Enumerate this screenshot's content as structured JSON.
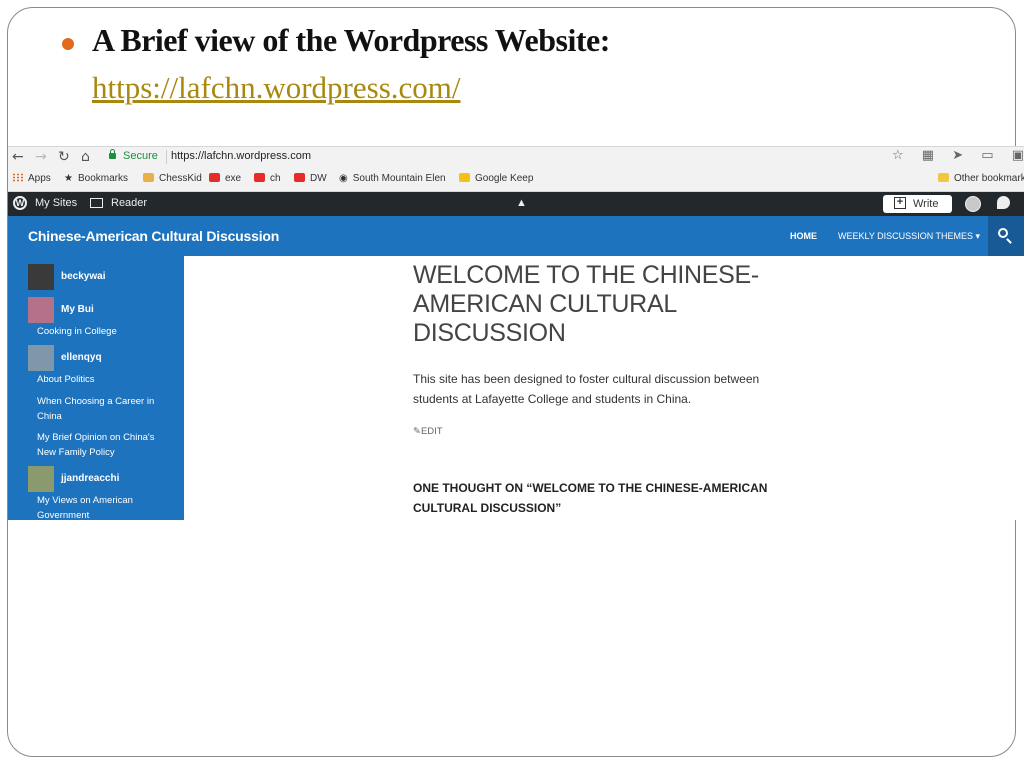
{
  "slide": {
    "title": "A Brief view of the Wordpress Website:",
    "link": "https://lafchn.wordpress.com/",
    "accent_color": "#e06a1a",
    "link_color": "#a8880f"
  },
  "browser": {
    "nav": {
      "back": "←",
      "forward": "→",
      "reload": "↻",
      "home": "⌂"
    },
    "secure_label": "Secure",
    "url": "https://lafchn.wordpress.com",
    "right_icons": [
      "star-icon",
      "extension-icon",
      "cursor-icon",
      "extension-icon",
      "lightbulb-icon"
    ],
    "bookmarks": {
      "apps": "Apps",
      "bookmarks": "Bookmarks",
      "chesskid": "ChessKid",
      "exe": "exe",
      "ch": "ch",
      "dw": "DW",
      "south_mountain": "South Mountain Elen",
      "google_keep": "Google Keep",
      "other": "Other bookmarks"
    }
  },
  "wp_bar": {
    "my_sites": "My Sites",
    "reader": "Reader",
    "write": "Write",
    "bg_color": "#23282d"
  },
  "site": {
    "title": "Chinese-American Cultural Discussion",
    "menu": {
      "home": "HOME",
      "themes": "WEEKLY DISCUSSION THEMES ▾"
    },
    "brand_color": "#1e73be"
  },
  "sidebar": {
    "users": [
      {
        "name": "beckywai",
        "posts": []
      },
      {
        "name": "My Bui",
        "posts": [
          "Cooking in College"
        ]
      },
      {
        "name": "ellenqyq",
        "posts": [
          "About Politics",
          "When Choosing a Career in China",
          "My Brief Opinion on China's New Family Policy"
        ]
      },
      {
        "name": "jjandreacchi",
        "posts": [
          "My Views on American Government"
        ]
      }
    ]
  },
  "main": {
    "post_title": "WELCOME TO THE CHINESE-AMERICAN CULTURAL DISCUSSION",
    "post_body": "This site has been designed to foster cultural discussion between students at Lafayette College and students in China.",
    "edit_label": "EDIT",
    "comments_title": "ONE THOUGHT ON “WELCOME TO THE CHINESE-AMERICAN CULTURAL DISCUSSION”"
  }
}
